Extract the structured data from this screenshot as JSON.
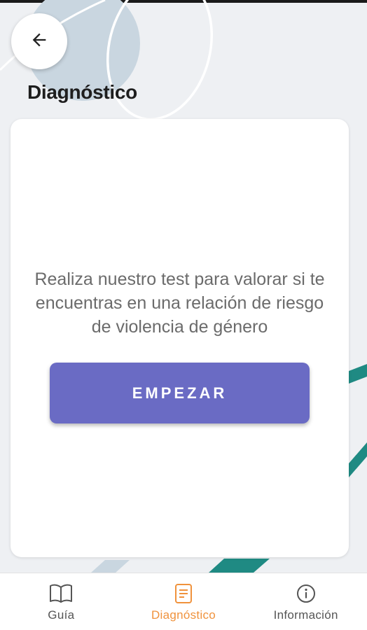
{
  "header": {
    "back_icon": "arrow-left-icon",
    "title": "Diagnóstico"
  },
  "card": {
    "description": "Realiza nuestro test para valorar si te encuentras en una relación de riesgo de violencia de género",
    "start_label": "EMPEZAR"
  },
  "bottom_nav": {
    "items": [
      {
        "label": "Guía",
        "icon": "book-icon",
        "active": false
      },
      {
        "label": "Diagnóstico",
        "icon": "document-icon",
        "active": true
      },
      {
        "label": "Información",
        "icon": "info-icon",
        "active": false
      }
    ]
  },
  "colors": {
    "accent": "#6a6bc4",
    "active_nav": "#f0923c",
    "decor_teal": "#1f8a83",
    "decor_blue": "#c9d6e0"
  }
}
